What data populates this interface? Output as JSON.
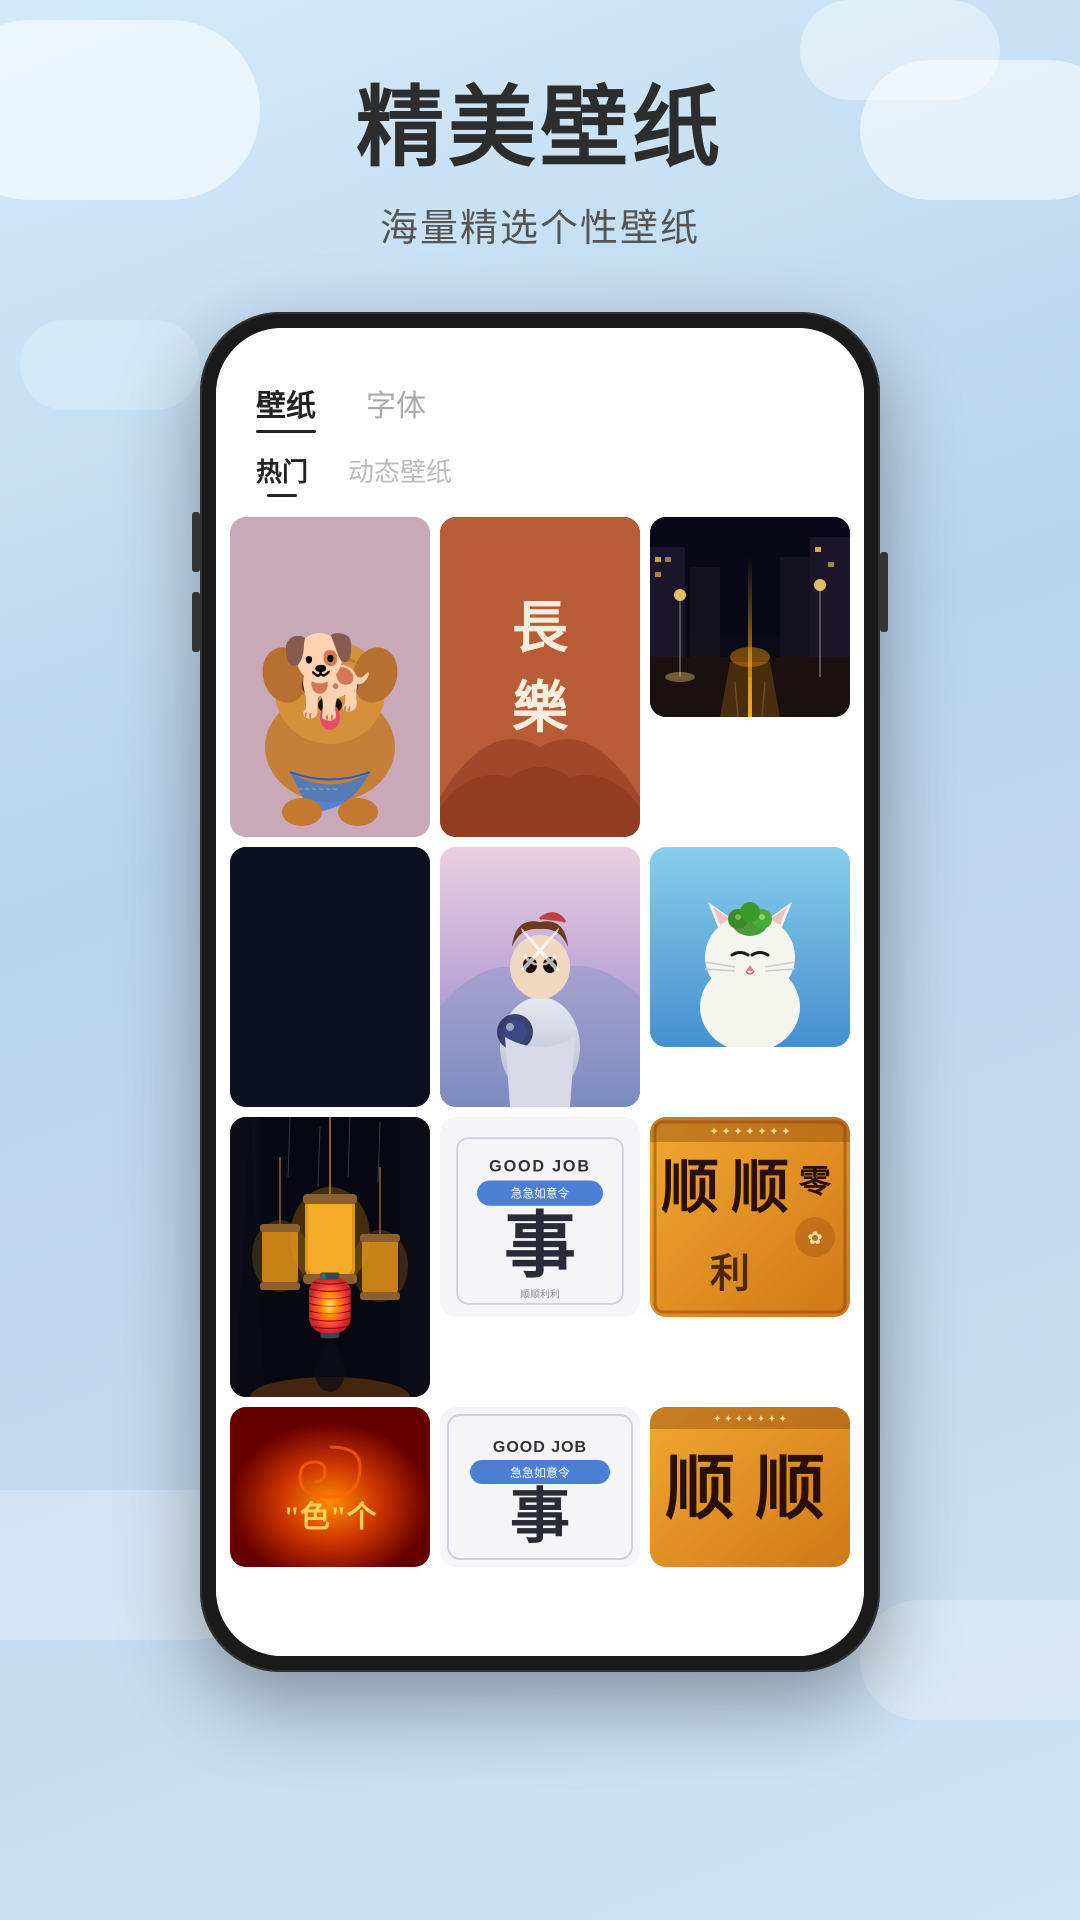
{
  "page": {
    "bg_color": "#c8dff0",
    "main_title": "精美壁纸",
    "sub_title": "海量精选个性壁纸"
  },
  "phone": {
    "tabs": [
      {
        "label": "壁纸",
        "active": true
      },
      {
        "label": "字体",
        "active": false
      }
    ],
    "sub_tabs": [
      {
        "label": "热门",
        "active": true
      },
      {
        "label": "动态壁纸",
        "active": false
      }
    ]
  },
  "wallpapers": [
    {
      "id": 1,
      "type": "dog",
      "col": 1,
      "row": 1,
      "desc": "柴犬壁纸"
    },
    {
      "id": 2,
      "type": "chinese-text",
      "col": 2,
      "row": 1,
      "text": "長樂",
      "desc": "长乐书法"
    },
    {
      "id": 3,
      "type": "street",
      "col": 3,
      "row": 1,
      "desc": "夜街风景"
    },
    {
      "id": 4,
      "type": "blue",
      "col": 3,
      "row": 2,
      "desc": "纯蓝壁纸"
    },
    {
      "id": 5,
      "type": "anime",
      "col": 2,
      "row": 2,
      "desc": "动漫角色"
    },
    {
      "id": 6,
      "type": "cat",
      "col": 3,
      "row": 2,
      "desc": "可爱猫咪"
    },
    {
      "id": 7,
      "type": "lantern",
      "col": 1,
      "row": 3,
      "desc": "日式灯笼"
    },
    {
      "id": 8,
      "type": "goodjob",
      "col": 2,
      "row": 3,
      "text": "GOOD JOB",
      "desc": "励志壁纸"
    },
    {
      "id": 9,
      "type": "chinese2",
      "col": 3,
      "row": 3,
      "text": "顺顺零",
      "desc": "中式壁纸"
    },
    {
      "id": 10,
      "type": "fire",
      "col": 1,
      "row": 4,
      "text": "\"色\"个",
      "desc": "火焰壁纸"
    }
  ],
  "goodjob_card": {
    "title": "GOOD JOB",
    "subtitle": "急急如意令",
    "badge": "急急如意令",
    "big_char": "事"
  }
}
